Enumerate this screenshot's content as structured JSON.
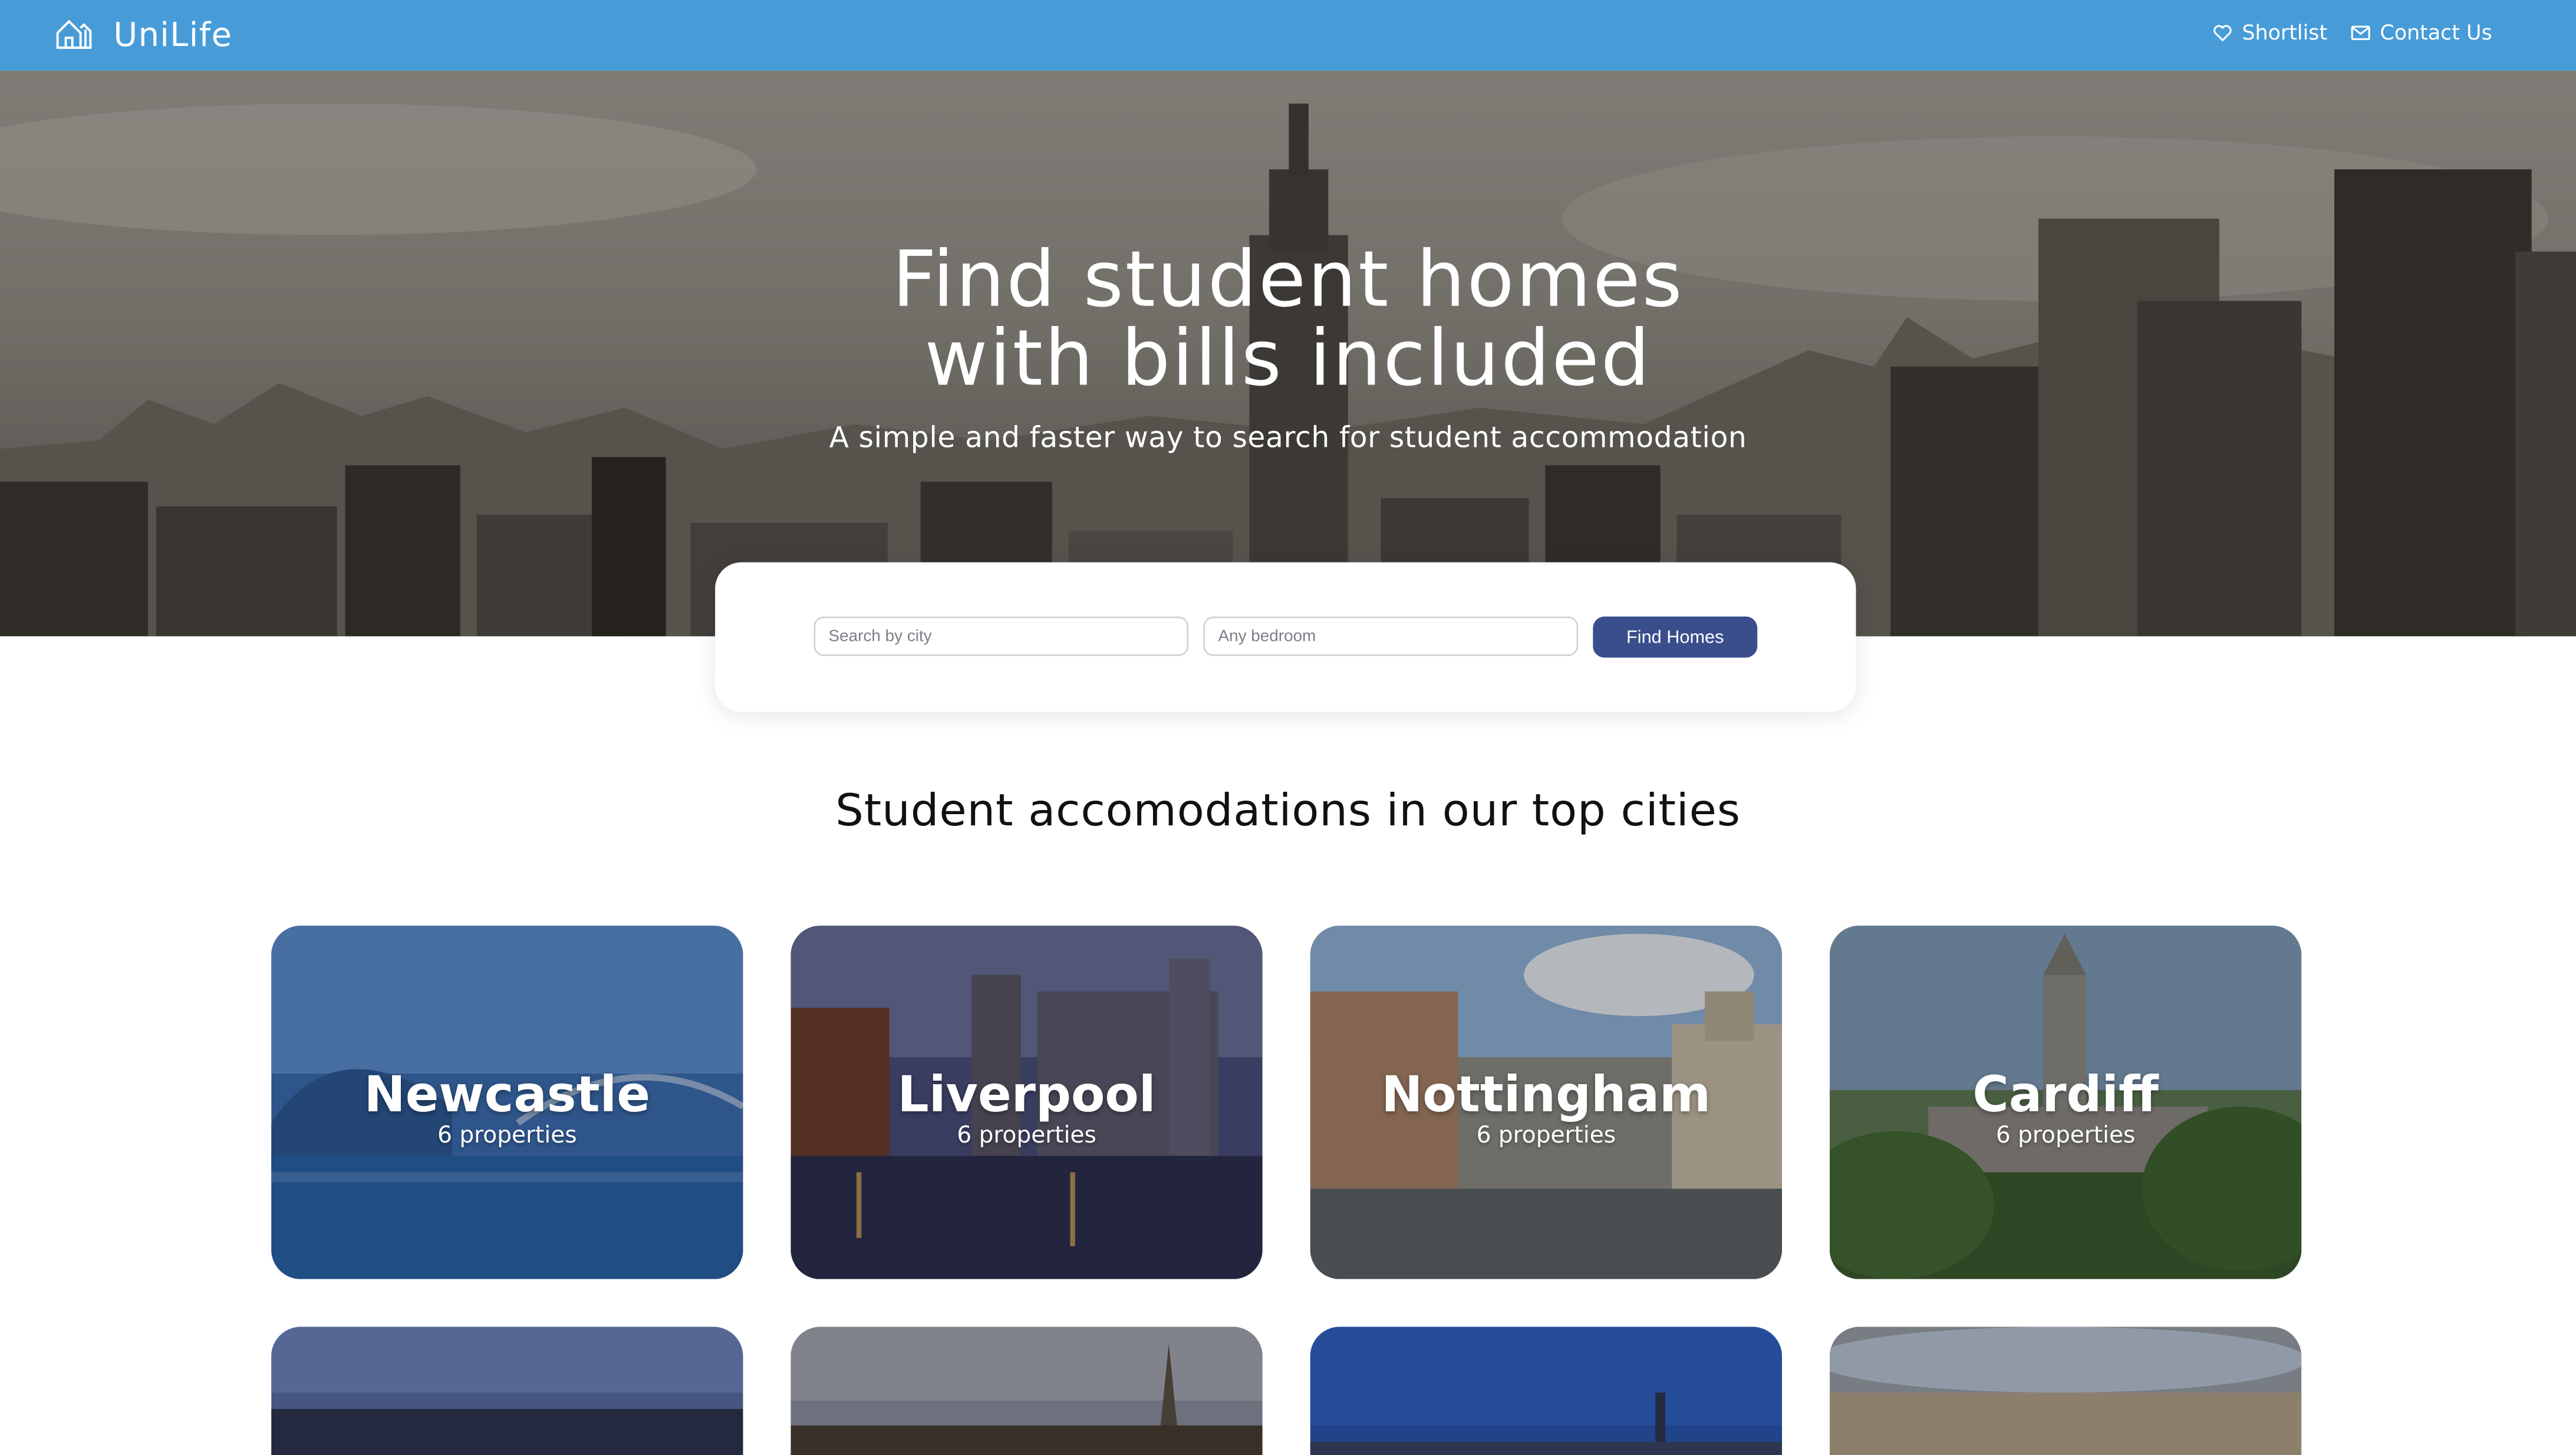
{
  "header": {
    "brand": "UniLife",
    "brand_icon": "house-logo-icon",
    "nav": {
      "shortlist": "Shortlist",
      "contact": "Contact Us"
    },
    "colors": {
      "bar": "#479cd8",
      "text": "#ffffff"
    }
  },
  "hero": {
    "title_line1": "Find student homes",
    "title_line2": "with bills included",
    "subtitle": "A simple and faster way to search for student accommodation"
  },
  "search": {
    "city_placeholder": "Search by city",
    "bedroom_placeholder": "Any bedroom",
    "button": "Find Homes",
    "button_color": "#3a4e8c"
  },
  "cities_section": {
    "title": "Student accomodations in our top cities",
    "cities": [
      {
        "name": "Newcastle",
        "count": "6 properties"
      },
      {
        "name": "Liverpool",
        "count": "6 properties"
      },
      {
        "name": "Nottingham",
        "count": "6 properties"
      },
      {
        "name": "Cardiff",
        "count": "6 properties"
      }
    ]
  }
}
